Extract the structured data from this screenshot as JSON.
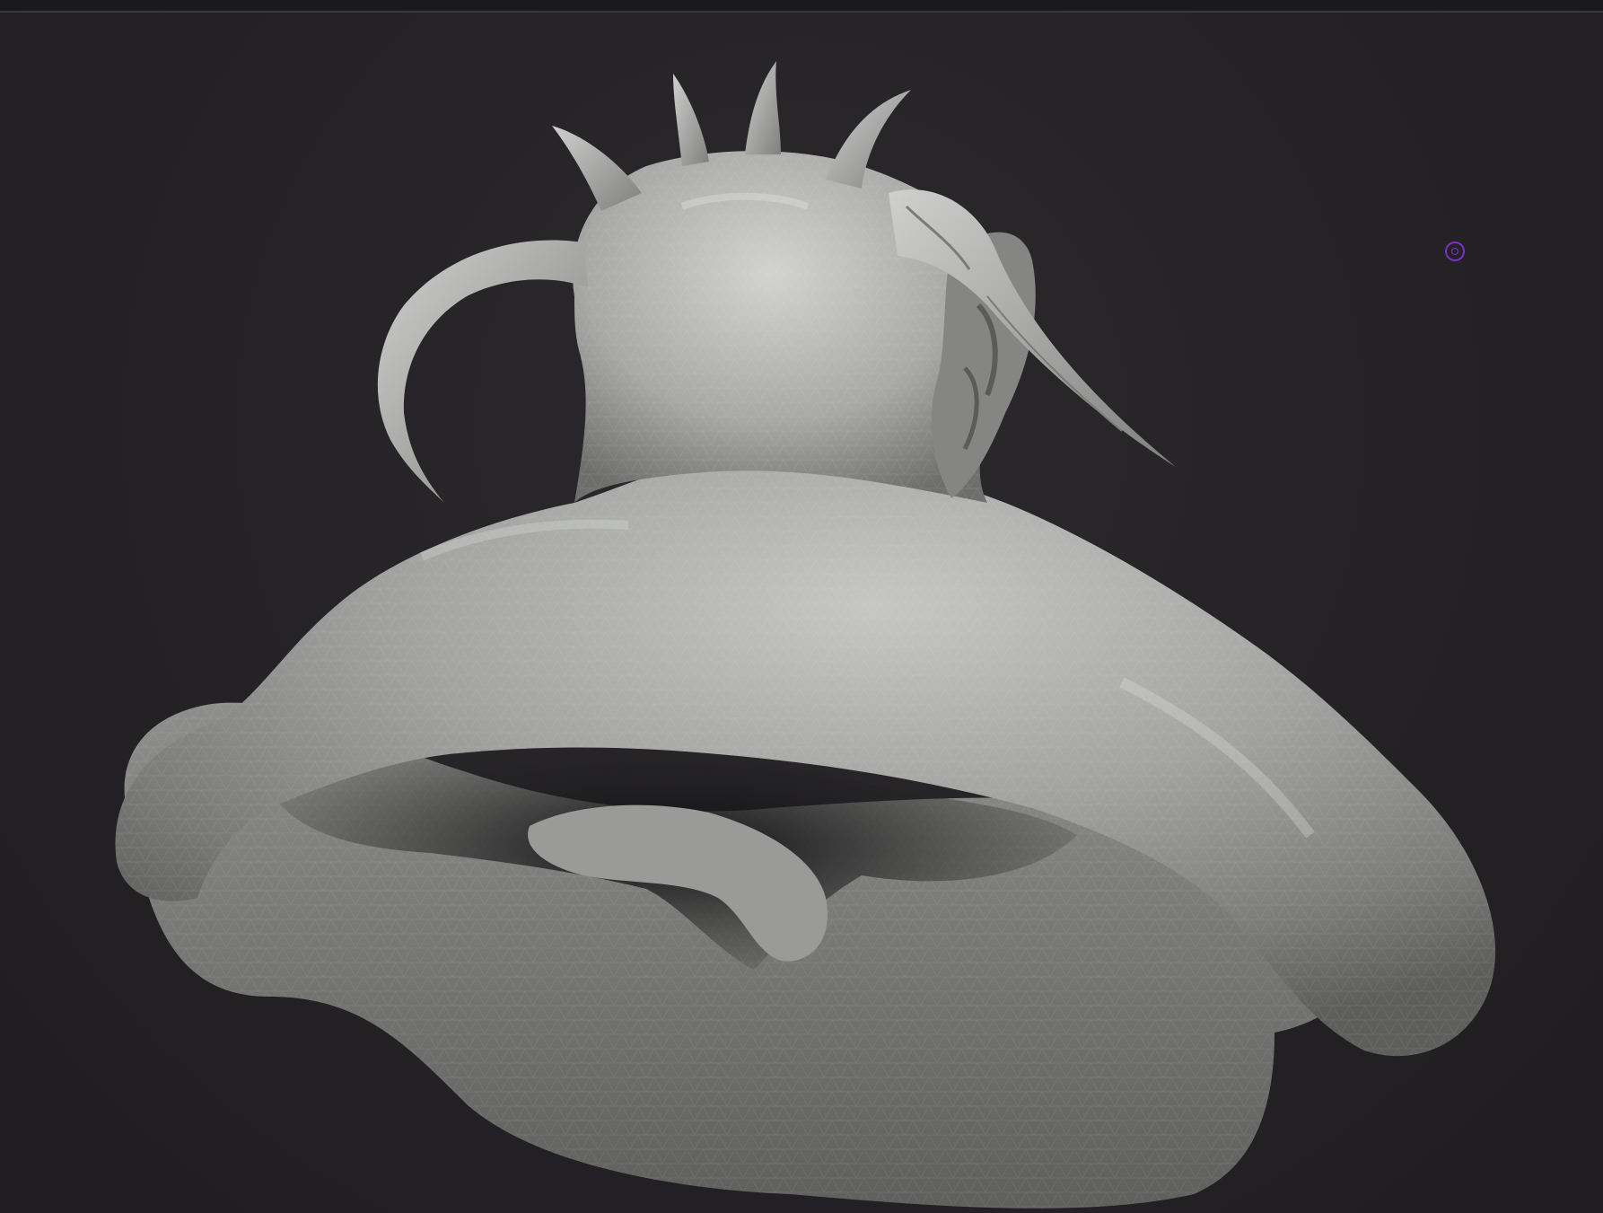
{
  "viewport": {
    "background_color": "#262427",
    "model_color": "#a9aaa8",
    "cursor_color": "#7a32c8",
    "content": "sculpt-mesh"
  },
  "icons": {
    "cursor": "brush-cursor-icon"
  }
}
